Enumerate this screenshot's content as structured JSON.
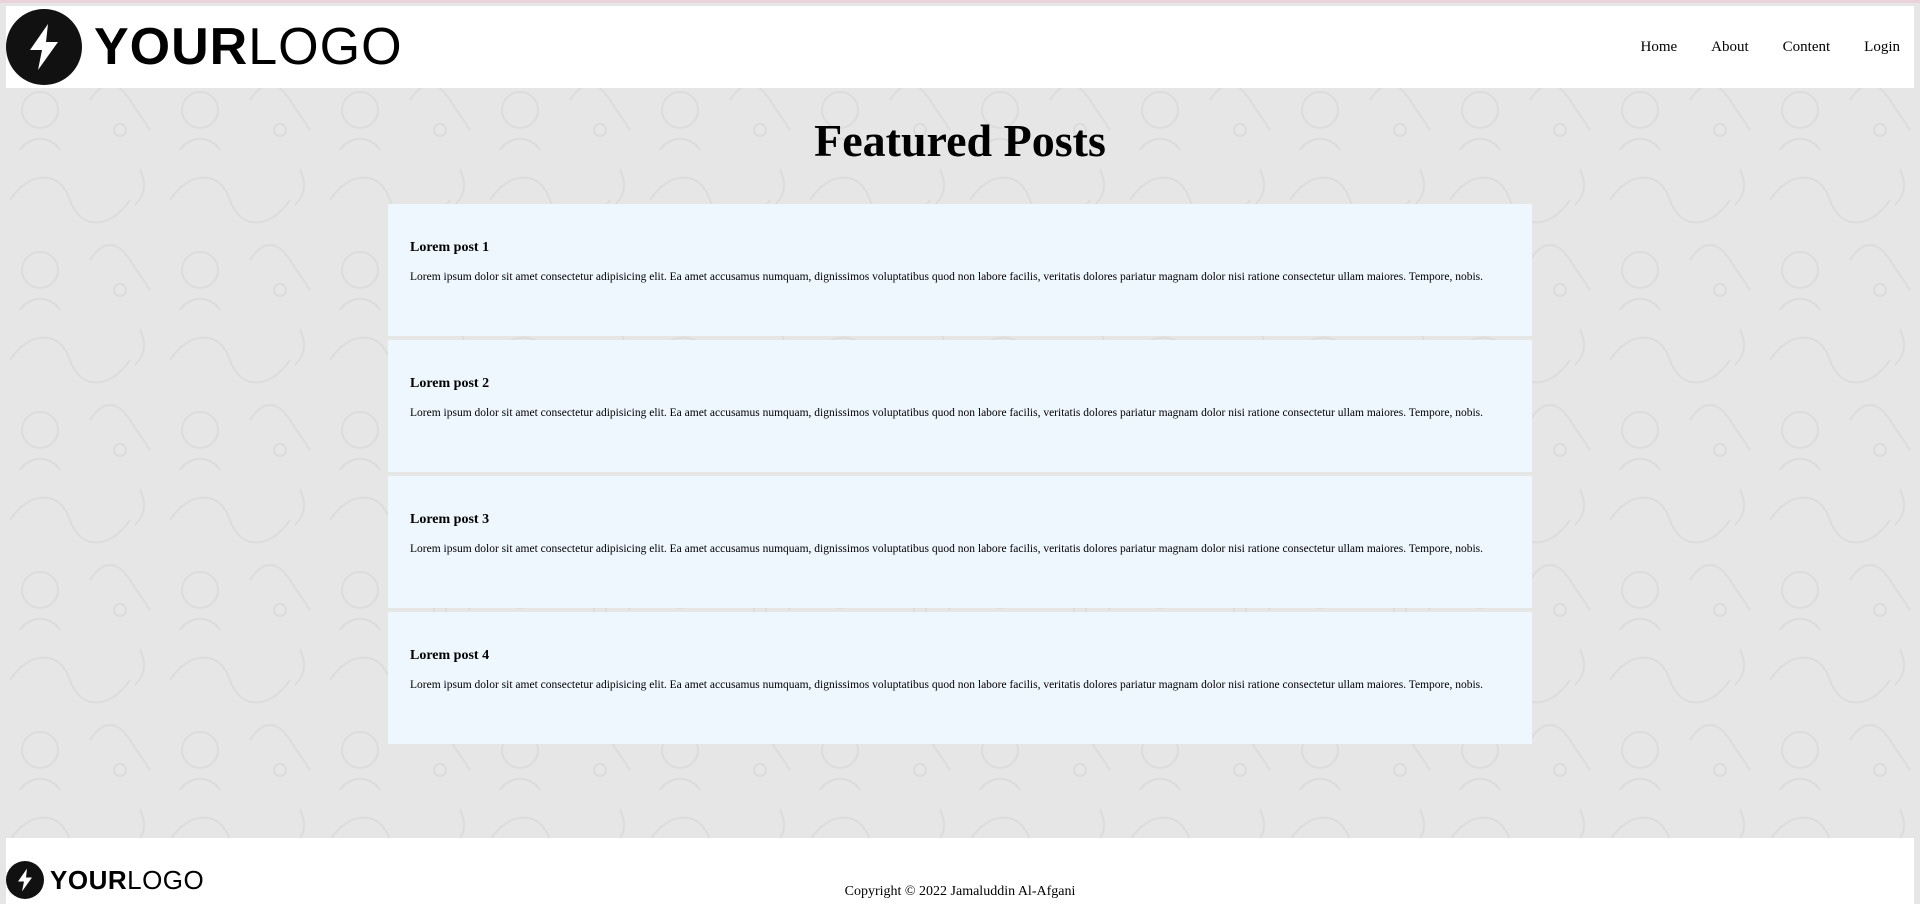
{
  "header": {
    "logo": {
      "bold": "YOUR",
      "regular": "LOGO",
      "icon": "lightning-bolt-icon"
    },
    "nav": [
      {
        "label": "Home"
      },
      {
        "label": "About"
      },
      {
        "label": "Content"
      },
      {
        "label": "Login"
      }
    ]
  },
  "main": {
    "title": "Featured Posts",
    "posts": [
      {
        "title": "Lorem post 1",
        "body": "Lorem ipsum dolor sit amet consectetur adipisicing elit. Ea amet accusamus numquam, dignissimos voluptatibus quod non labore facilis, veritatis dolores pariatur magnam dolor nisi ratione consectetur ullam maiores. Tempore, nobis."
      },
      {
        "title": "Lorem post 2",
        "body": "Lorem ipsum dolor sit amet consectetur adipisicing elit. Ea amet accusamus numquam, dignissimos voluptatibus quod non labore facilis, veritatis dolores pariatur magnam dolor nisi ratione consectetur ullam maiores. Tempore, nobis."
      },
      {
        "title": "Lorem post 3",
        "body": "Lorem ipsum dolor sit amet consectetur adipisicing elit. Ea amet accusamus numquam, dignissimos voluptatibus quod non labore facilis, veritatis dolores pariatur magnam dolor nisi ratione consectetur ullam maiores. Tempore, nobis."
      },
      {
        "title": "Lorem post 4",
        "body": "Lorem ipsum dolor sit amet consectetur adipisicing elit. Ea amet accusamus numquam, dignissimos voluptatibus quod non labore facilis, veritatis dolores pariatur magnam dolor nisi ratione consectetur ullam maiores. Tempore, nobis."
      }
    ]
  },
  "footer": {
    "logo": {
      "bold": "YOUR",
      "regular": "LOGO",
      "icon": "lightning-bolt-icon"
    },
    "copyright": "Copyright © 2022 Jamaluddin Al-Afgani"
  },
  "colors": {
    "background": "#e6e6e6",
    "post_background": "#eef6fe",
    "header_background": "#ffffff",
    "logo_mark": "#111111"
  }
}
